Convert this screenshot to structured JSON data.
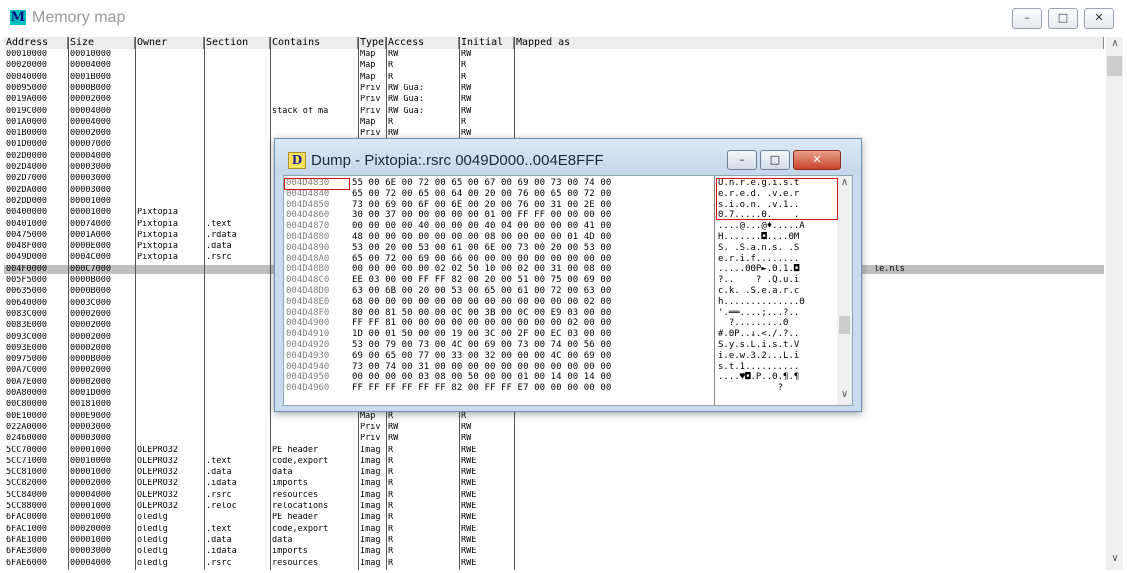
{
  "window": {
    "app_icon": "M",
    "title": "Memory map",
    "minimize": "–",
    "maximize": "□",
    "close": "✕"
  },
  "columns": [
    "Address",
    "Size",
    "Owner",
    "Section",
    "Contains",
    "Type",
    "Access",
    "Initial",
    "Mapped as"
  ],
  "rows": [
    [
      "00010000",
      "00010000",
      "",
      "",
      "",
      "Map",
      "RW",
      "RW",
      ""
    ],
    [
      "00020000",
      "00004000",
      "",
      "",
      "",
      "Map",
      "R",
      "R",
      ""
    ],
    [
      "00040000",
      "0001B000",
      "",
      "",
      "",
      "Map",
      "R",
      "R",
      ""
    ],
    [
      "00095000",
      "0000B000",
      "",
      "",
      "",
      "Priv",
      "RW   Gua:",
      "RW",
      ""
    ],
    [
      "0019A000",
      "00002000",
      "",
      "",
      "",
      "Priv",
      "RW   Gua:",
      "RW",
      ""
    ],
    [
      "0019C000",
      "00004000",
      "",
      "",
      "stack of ma",
      "Priv",
      "RW   Gua:",
      "RW",
      ""
    ],
    [
      "001A0000",
      "00004000",
      "",
      "",
      "",
      "Map",
      "R",
      "R",
      ""
    ],
    [
      "001B0000",
      "00002000",
      "",
      "",
      "",
      "Priv",
      "RW",
      "RW",
      ""
    ],
    [
      "001D0000",
      "00007000",
      "",
      "",
      "",
      "",
      "",
      "",
      ""
    ],
    [
      "002D0000",
      "00004000",
      "",
      "",
      "",
      "",
      "",
      "",
      ""
    ],
    [
      "002D4000",
      "00003000",
      "",
      "",
      "",
      "",
      "",
      "",
      ""
    ],
    [
      "002D7000",
      "00003000",
      "",
      "",
      "",
      "",
      "",
      "",
      ""
    ],
    [
      "002DA000",
      "00003000",
      "",
      "",
      "",
      "",
      "",
      "",
      ""
    ],
    [
      "002DD000",
      "00001000",
      "",
      "",
      "",
      "",
      "",
      "",
      ""
    ],
    [
      "00400000",
      "00001000",
      "Pixtopia",
      "",
      "",
      "",
      "",
      "",
      ""
    ],
    [
      "00401000",
      "00074000",
      "Pixtopia",
      ".text",
      "",
      "",
      "",
      "",
      ""
    ],
    [
      "00475000",
      "0001A000",
      "Pixtopia",
      ".rdata",
      "",
      "",
      "",
      "",
      ""
    ],
    [
      "0048F000",
      "0000E000",
      "Pixtopia",
      ".data",
      "",
      "",
      "",
      "",
      ""
    ],
    [
      "0049D000",
      "0004C000",
      "Pixtopia",
      ".rsrc",
      "",
      "",
      "",
      "",
      ""
    ],
    [
      "004F0000",
      "000C7000",
      "",
      "",
      "",
      "",
      "",
      "",
      "le.nls"
    ],
    [
      "005F5000",
      "0000B000",
      "",
      "",
      "",
      "",
      "",
      "",
      ""
    ],
    [
      "00635000",
      "0000B000",
      "",
      "",
      "",
      "",
      "",
      "",
      ""
    ],
    [
      "00640000",
      "0003C000",
      "",
      "",
      "",
      "",
      "",
      "",
      ""
    ],
    [
      "0083C000",
      "00002000",
      "",
      "",
      "",
      "",
      "",
      "",
      ""
    ],
    [
      "0083E000",
      "00002000",
      "",
      "",
      "",
      "",
      "",
      "",
      ""
    ],
    [
      "0093C000",
      "00002000",
      "",
      "",
      "",
      "",
      "",
      "",
      ""
    ],
    [
      "0093E000",
      "00002000",
      "",
      "",
      "",
      "",
      "",
      "",
      ""
    ],
    [
      "00975000",
      "0000B000",
      "",
      "",
      "",
      "",
      "",
      "",
      ""
    ],
    [
      "00A7C000",
      "00002000",
      "",
      "",
      "",
      "",
      "",
      "",
      ""
    ],
    [
      "00A7E000",
      "00002000",
      "",
      "",
      "",
      "",
      "",
      "",
      ""
    ],
    [
      "00A80000",
      "0001D000",
      "",
      "",
      "",
      "",
      "",
      "",
      ""
    ],
    [
      "00C80000",
      "00181000",
      "",
      "",
      "",
      "",
      "",
      "",
      ""
    ],
    [
      "00E10000",
      "000E9000",
      "",
      "",
      "",
      "Map",
      "R",
      "R",
      ""
    ],
    [
      "022A0000",
      "00003000",
      "",
      "",
      "",
      "Priv",
      "RW",
      "RW",
      ""
    ],
    [
      "02460000",
      "00003000",
      "",
      "",
      "",
      "Priv",
      "RW",
      "RW",
      ""
    ],
    [
      "5CC70000",
      "00001000",
      "OLEPRO32",
      "",
      "PE header",
      "Imag",
      "R",
      "RWE",
      ""
    ],
    [
      "5CC71000",
      "00010000",
      "OLEPRO32",
      ".text",
      "code,export",
      "Imag",
      "R",
      "RWE",
      ""
    ],
    [
      "5CC81000",
      "00001000",
      "OLEPRO32",
      ".data",
      "data",
      "Imag",
      "R",
      "RWE",
      ""
    ],
    [
      "5CC82000",
      "00002000",
      "OLEPRO32",
      ".idata",
      "imports",
      "Imag",
      "R",
      "RWE",
      ""
    ],
    [
      "5CC84000",
      "00004000",
      "OLEPRO32",
      ".rsrc",
      "resources",
      "Imag",
      "R",
      "RWE",
      ""
    ],
    [
      "5CC88000",
      "00001000",
      "OLEPRO32",
      ".reloc",
      "relocations",
      "Imag",
      "R",
      "RWE",
      ""
    ],
    [
      "6FAC0000",
      "00001000",
      "oledlg",
      "",
      "PE header",
      "Imag",
      "R",
      "RWE",
      ""
    ],
    [
      "6FAC1000",
      "00020000",
      "oledlg",
      ".text",
      "code,export",
      "Imag",
      "R",
      "RWE",
      ""
    ],
    [
      "6FAE1000",
      "00001000",
      "oledlg",
      ".data",
      "data",
      "Imag",
      "R",
      "RWE",
      ""
    ],
    [
      "6FAE3000",
      "00003000",
      "oledlg",
      ".idata",
      "imports",
      "Imag",
      "R",
      "RWE",
      ""
    ],
    [
      "6FAE6000",
      "00004000",
      "oledlg",
      ".rsrc",
      "resources",
      "Imag",
      "R",
      "RWE",
      ""
    ]
  ],
  "dump": {
    "icon": "D",
    "title": "Dump - Pixtopia:.rsrc 0049D000..004E8FFF",
    "minimize": "–",
    "maximize": "□",
    "close": "✕",
    "lines": [
      {
        "addr": "004D4830",
        "hex": "55 00 6E 00 72 00 65 00 67 00 69 00 73 00 74 00",
        "ascii": "U.n.r.e.g.i.s.t"
      },
      {
        "addr": "004D4840",
        "hex": "65 00 72 00 65 00 64 00 20 00 76 00 65 00 72 00",
        "ascii": "e.r.e.d. .v.e.r"
      },
      {
        "addr": "004D4850",
        "hex": "73 00 69 00 6F 00 6E 00 20 00 76 00 31 00 2E 00",
        "ascii": "s.i.o.n. .v.1.."
      },
      {
        "addr": "004D4860",
        "hex": "30 00 37 00 00 00 00 00 01 00 FF FF 00 00 00 00",
        "ascii": "0.7.....Θ.    ."
      },
      {
        "addr": "004D4870",
        "hex": "00 00 00 00 40 00 00 00 40 04 00 00 00 00 41 00",
        "ascii": "....@...@♦.....A"
      },
      {
        "addr": "004D4880",
        "hex": "48 00 00 00 00 00 00 00 08 00 00 00 00 01 4D 00",
        "ascii": "H.......◘....ΘM"
      },
      {
        "addr": "004D4890",
        "hex": "53 00 20 00 53 00 61 00 6E 00 73 00 20 00 53 00",
        "ascii": "S. .S.a.n.s. .S"
      },
      {
        "addr": "004D48A0",
        "hex": "65 00 72 00 69 00 66 00 00 00 00 00 00 00 00 00",
        "ascii": "e.r.i.f........"
      },
      {
        "addr": "004D48B0",
        "hex": "00 00 00 00 00 02 02 50 10 00 02 00 31 00 08 00",
        "ascii": ".....ΘΘP►.Θ.1.◘"
      },
      {
        "addr": "004D48C0",
        "hex": "EE 03 00 00 FF FF 82 00 20 00 51 00 75 00 69 00",
        "ascii": "?..    ? .Q.u.i"
      },
      {
        "addr": "004D48D0",
        "hex": "63 00 6B 00 20 00 53 00 65 00 61 00 72 00 63 00",
        "ascii": "c.k. .S.e.a.r.c"
      },
      {
        "addr": "004D48E0",
        "hex": "68 00 00 00 00 00 00 00 00 00 00 00 00 00 02 00",
        "ascii": "h..............Θ"
      },
      {
        "addr": "004D48F0",
        "hex": "80 00 81 50 00 00 0C 00 3B 00 0C 00 E9 03 00 00",
        "ascii": "'.══....;...?.."
      },
      {
        "addr": "004D4900",
        "hex": "FF FF 81 00 00 00 00 00 00 00 00 00 00 02 00 00",
        "ascii": "  ?.........Θ"
      },
      {
        "addr": "004D4910",
        "hex": "1D 00 01 50 00 00 19 00 3C 00 2F 00 EC 03 00 00",
        "ascii": "#.ΘP..↓.<./.?.."
      },
      {
        "addr": "004D4920",
        "hex": "53 00 79 00 73 00 4C 00 69 00 73 00 74 00 56 00",
        "ascii": "S.y.s.L.i.s.t.V"
      },
      {
        "addr": "004D4930",
        "hex": "69 00 65 00 77 00 33 00 32 00 00 00 4C 00 69 00",
        "ascii": "i.e.w.3.2...L.i"
      },
      {
        "addr": "004D4940",
        "hex": "73 00 74 00 31 00 00 00 00 00 00 00 00 00 00 00",
        "ascii": "s.t.1.........."
      },
      {
        "addr": "004D4950",
        "hex": "00 00 00 00 03 08 00 50 00 00 01 00 14 00 14 00",
        "ascii": "....♥◘.P..Θ.¶.¶"
      },
      {
        "addr": "004D4960",
        "hex": "FF FF FF FF FF FF 82 00 FF FF E7 00 00 00 00 00",
        "ascii": "           ?"
      }
    ]
  }
}
